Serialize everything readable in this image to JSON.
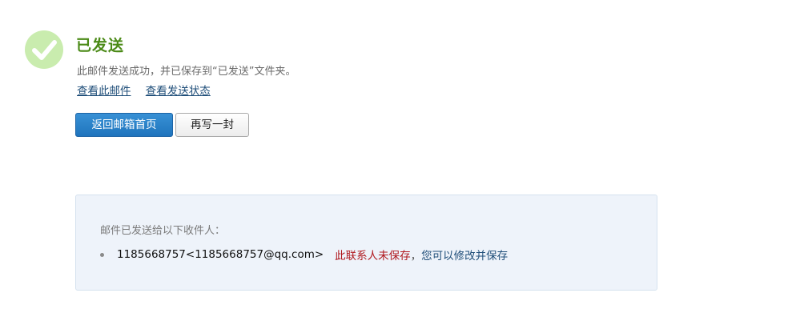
{
  "status": {
    "title": "已发送",
    "description": "此邮件发送成功，并已保存到“已发送”文件夹。",
    "icon": "check-circle-icon",
    "icon_color": "#c9ecae",
    "title_color": "#4b8a17"
  },
  "links": {
    "view_mail": "查看此邮件",
    "view_status": "查看发送状态"
  },
  "buttons": {
    "back_home": "返回邮箱首页",
    "write_another": "再写一封"
  },
  "recipients": {
    "heading": "邮件已发送给以下收件人：",
    "items": [
      {
        "address": "1185668757<1185668757@qq.com>",
        "unsaved_text": "此联系人未保存",
        "separator": "，",
        "action_text": "您可以修改并保存"
      }
    ]
  }
}
